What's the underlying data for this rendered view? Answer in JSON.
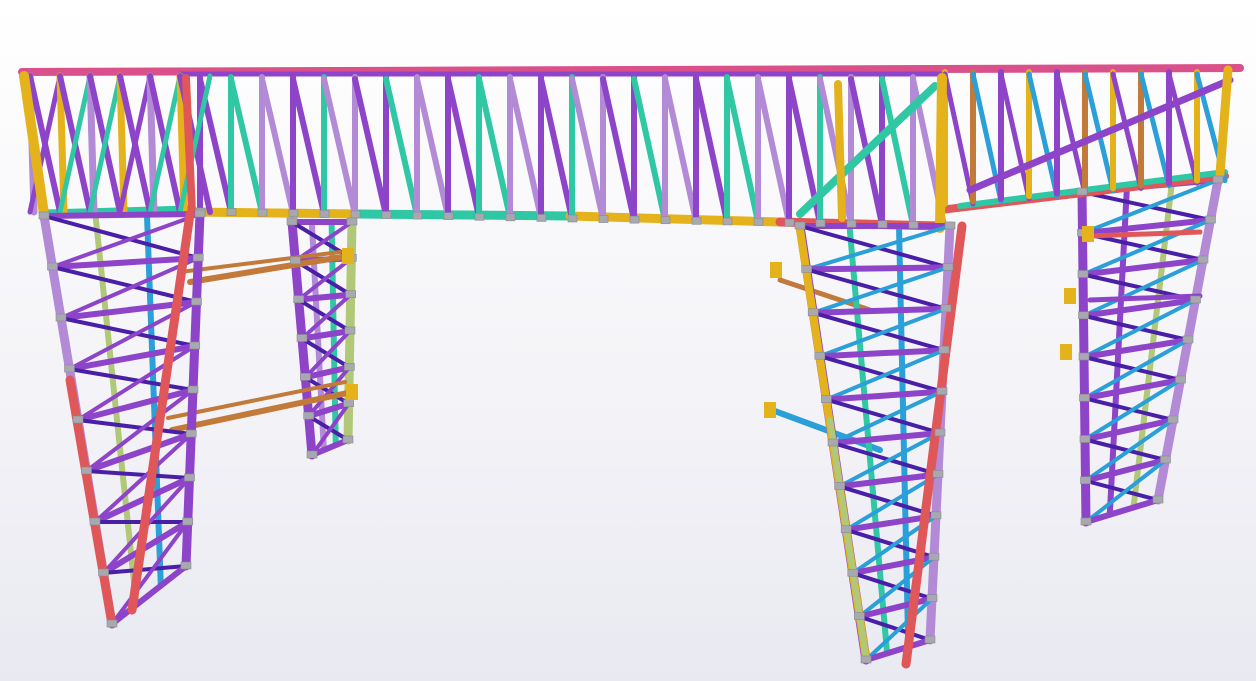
{
  "viewport": {
    "name": "3d-model-view",
    "background_top": "#ffffff",
    "background_bottom": "#e9e9f1"
  },
  "model": {
    "type": "steel-truss-structure",
    "members": [
      "tower-front-left",
      "tower-rear-left",
      "tower-front-right",
      "tower-rear-right",
      "top-truss-bridge",
      "side-outrigger-beams"
    ]
  },
  "colors": {
    "teal": "#2fc7a4",
    "violet": "#8e44c9",
    "lavender": "#b28ad6",
    "indigo": "#4a1fa8",
    "yellow": "#e4b21a",
    "salmon": "#e0575a",
    "pink": "#d9508a",
    "sky": "#2a9fd8",
    "brown": "#c27a3a",
    "olive": "#b0c878",
    "grey": "#a8a8b0"
  }
}
